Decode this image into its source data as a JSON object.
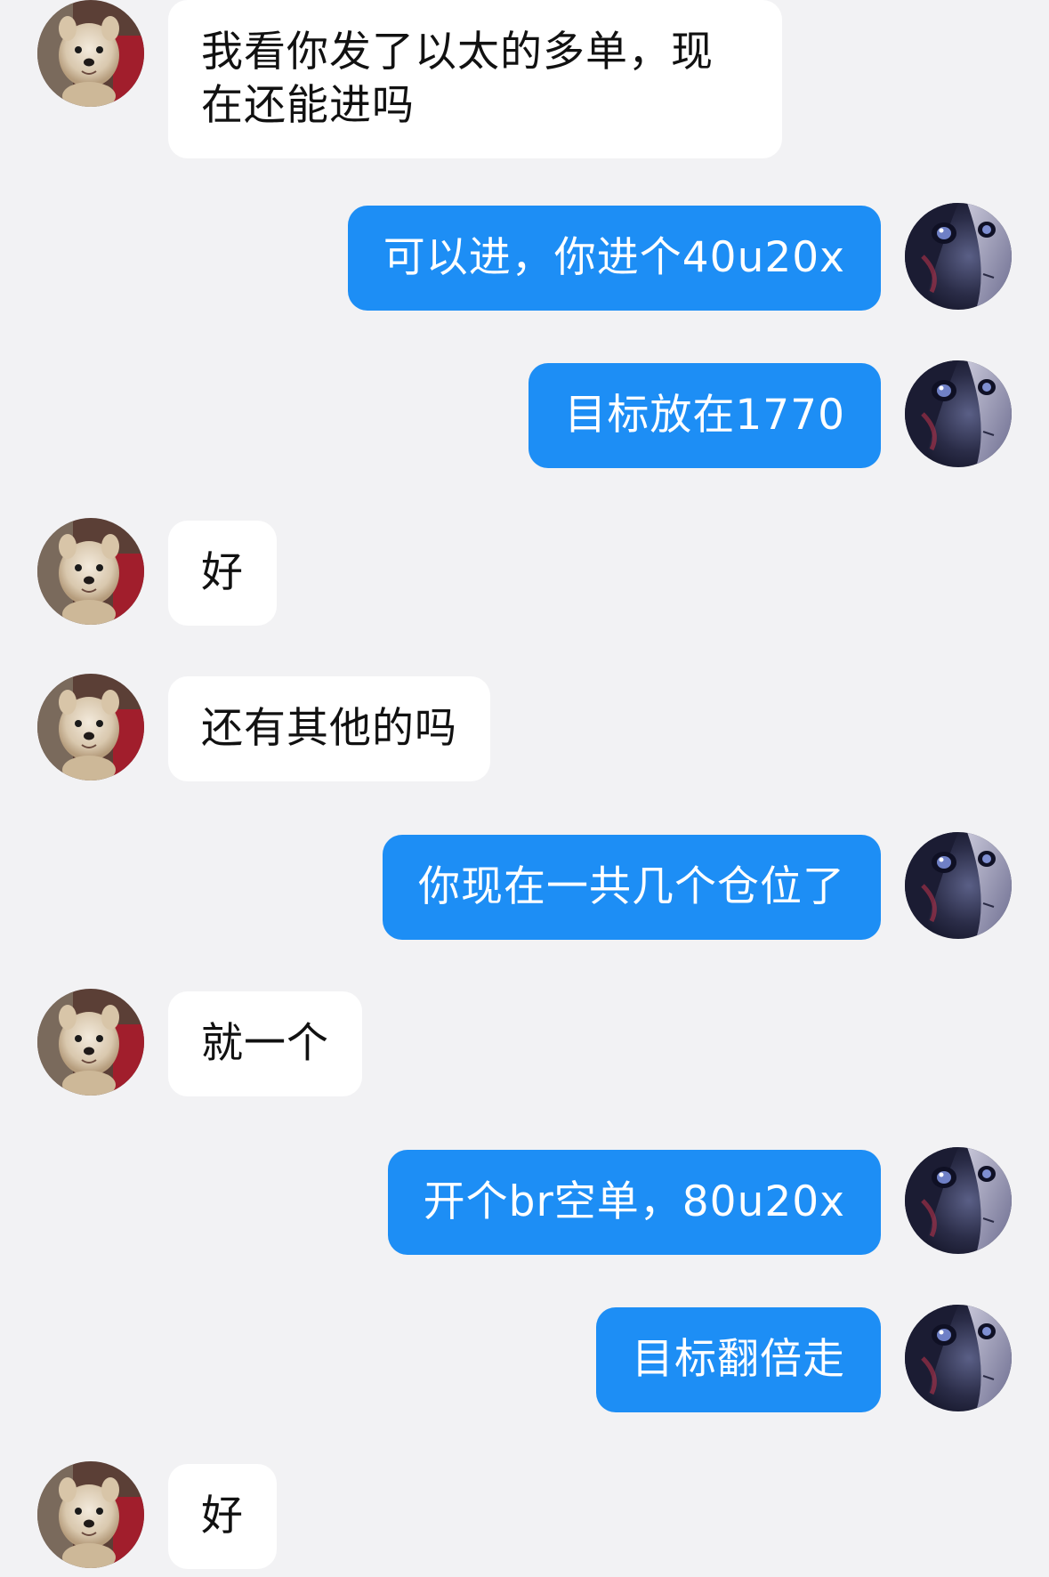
{
  "conversation": {
    "messages": [
      {
        "sender": "contact",
        "text": "我看你发了以太的多单，现在还能进吗"
      },
      {
        "sender": "me",
        "text": "可以进，你进个40u20x"
      },
      {
        "sender": "me",
        "text": "目标放在1770"
      },
      {
        "sender": "contact",
        "text": "好"
      },
      {
        "sender": "contact",
        "text": "还有其他的吗"
      },
      {
        "sender": "me",
        "text": "你现在一共几个仓位了"
      },
      {
        "sender": "contact",
        "text": "就一个"
      },
      {
        "sender": "me",
        "text": "开个br空单，80u20x"
      },
      {
        "sender": "me",
        "text": "目标翻倍走"
      },
      {
        "sender": "contact",
        "text": "好"
      }
    ]
  },
  "theme": {
    "background": "#f2f2f4",
    "incoming_bubble": "#ffffff",
    "outgoing_bubble": "#1d8ef5",
    "incoming_text": "#111111",
    "outgoing_text": "#ffffff"
  },
  "avatars": {
    "contact": "dog-photo-avatar",
    "me": "anime-portrait-avatar"
  }
}
